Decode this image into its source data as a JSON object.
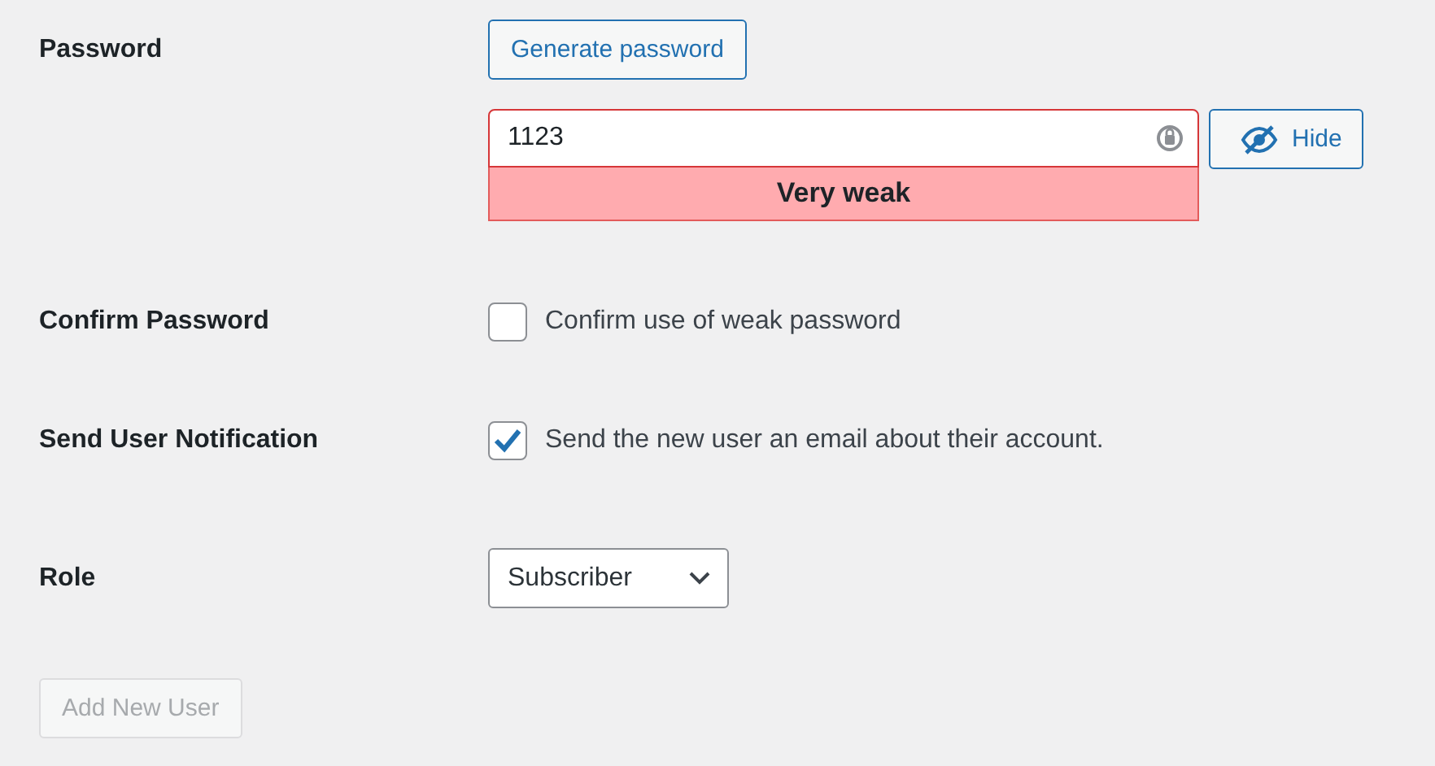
{
  "password": {
    "label": "Password",
    "generate_button": "Generate password",
    "value": "1123",
    "strength": {
      "text": "Very weak",
      "kind": "short"
    },
    "toggle_button": {
      "label": "Hide"
    }
  },
  "confirm_password": {
    "label": "Confirm Password",
    "option": "Confirm use of weak password",
    "checked": false
  },
  "send_notification": {
    "label": "Send User Notification",
    "option": "Send the new user an email about their account.",
    "checked": true
  },
  "role": {
    "label": "Role",
    "value": "Subscriber"
  },
  "submit": {
    "label": "Add New User",
    "disabled": true
  }
}
